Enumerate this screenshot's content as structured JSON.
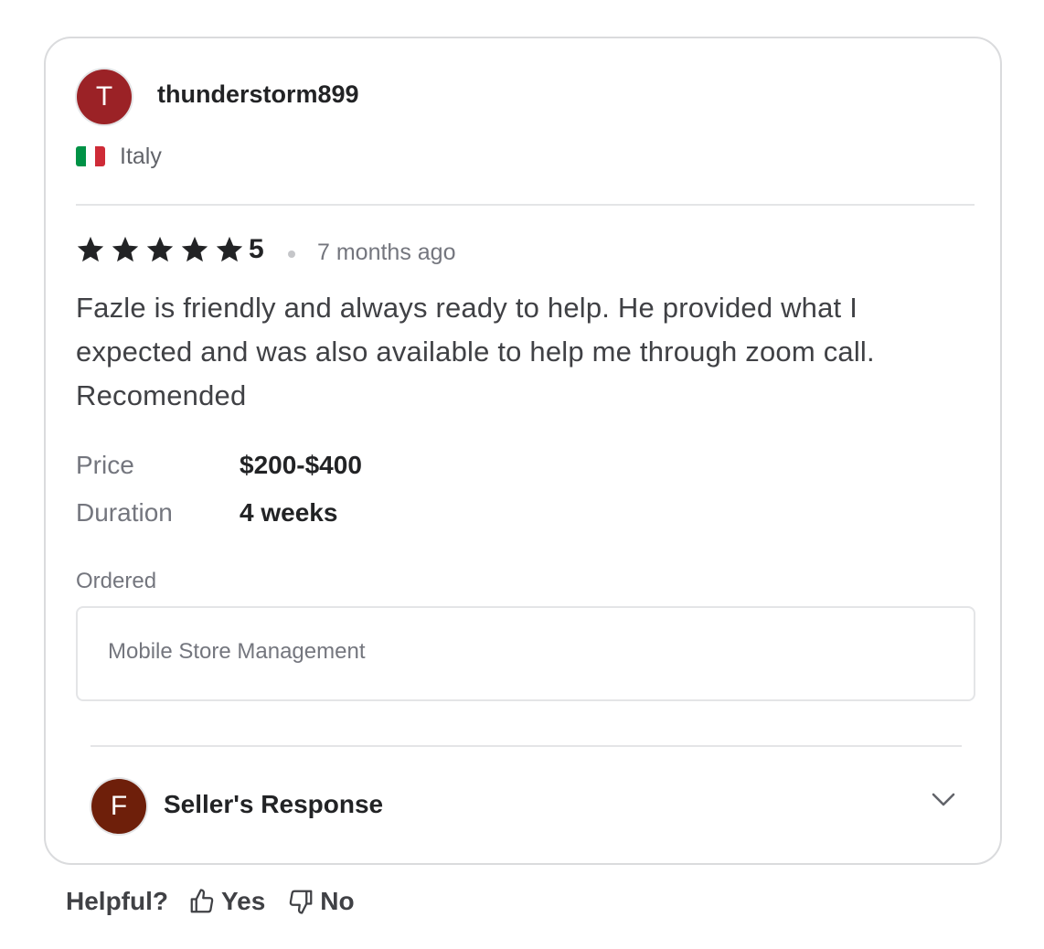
{
  "review": {
    "avatar_initial": "T",
    "username": "thunderstorm899",
    "country": "Italy",
    "flag_colors": [
      "#009246",
      "#ffffff",
      "#ce2b37"
    ],
    "rating": 5,
    "rating_label": "5",
    "time_ago": "7 months ago",
    "text": "Fazle is friendly and always ready to help. He provided what I expected and was also available to help me through zoom call. Recomended",
    "price_label": "Price",
    "price_value": "$200-$400",
    "duration_label": "Duration",
    "duration_value": "4 weeks",
    "ordered_label": "Ordered",
    "ordered_item": "Mobile Store Management"
  },
  "seller_response": {
    "avatar_initial": "F",
    "label": "Seller's Response",
    "icon": "chevron-down-icon"
  },
  "helpful": {
    "question": "Helpful?",
    "yes_label": "Yes",
    "no_label": "No",
    "yes_icon": "thumbs-up-icon",
    "no_icon": "thumbs-down-icon"
  },
  "colors": {
    "user_avatar": "#9b2226",
    "seller_avatar": "#6e1f0a",
    "star": "#222325",
    "border": "#dadbdd"
  }
}
